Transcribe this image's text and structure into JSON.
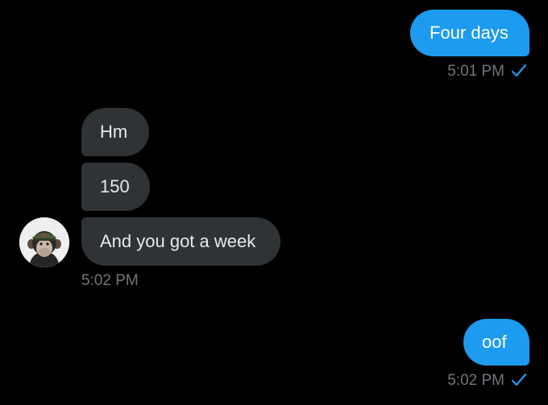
{
  "thread": {
    "messages": [
      {
        "direction": "outgoing",
        "text": "Four days",
        "time": "5:01 PM"
      },
      {
        "direction": "incoming",
        "text": "Hm"
      },
      {
        "direction": "incoming",
        "text": "150"
      },
      {
        "direction": "incoming",
        "text": "And you got a week",
        "time": "5:02 PM"
      },
      {
        "direction": "outgoing",
        "text": "oof",
        "time": "5:02 PM"
      }
    ]
  },
  "icons": {
    "read_receipt": "check-icon",
    "avatar": "chimpanzee-avatar"
  },
  "colors": {
    "background": "#000000",
    "outgoing_bubble": "#1d9bf0",
    "incoming_bubble": "#2f3336",
    "timestamp": "#71767b",
    "check": "#1d9bf0"
  }
}
